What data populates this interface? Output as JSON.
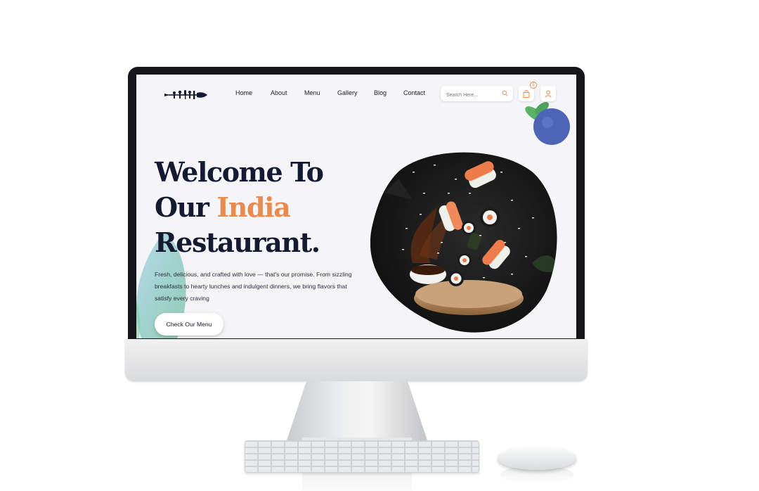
{
  "nav": {
    "items": [
      {
        "label": "Home"
      },
      {
        "label": "About"
      },
      {
        "label": "Menu"
      },
      {
        "label": "Gallery"
      },
      {
        "label": "Blog"
      },
      {
        "label": "Contact"
      }
    ]
  },
  "search": {
    "placeholder": "Search Here..."
  },
  "cart": {
    "count": "5"
  },
  "hero": {
    "title_line1": "Welcome To",
    "title_line2_prefix": "Our ",
    "title_line2_accent": "India",
    "title_line3": "Restaurant.",
    "description": "Fresh, delicious, and crafted with love — that's our promise. From sizzling breakfasts to hearty lunches and indulgent dinners, we bring flavors that satisfy every craving",
    "cta_label": "Check Our Menu"
  },
  "colors": {
    "accent": "#e98a4e",
    "title": "#151a33",
    "screen_bg": "#f5f5f7"
  },
  "icons": [
    "search-icon",
    "cart-icon",
    "user-icon",
    "logo-icon"
  ]
}
